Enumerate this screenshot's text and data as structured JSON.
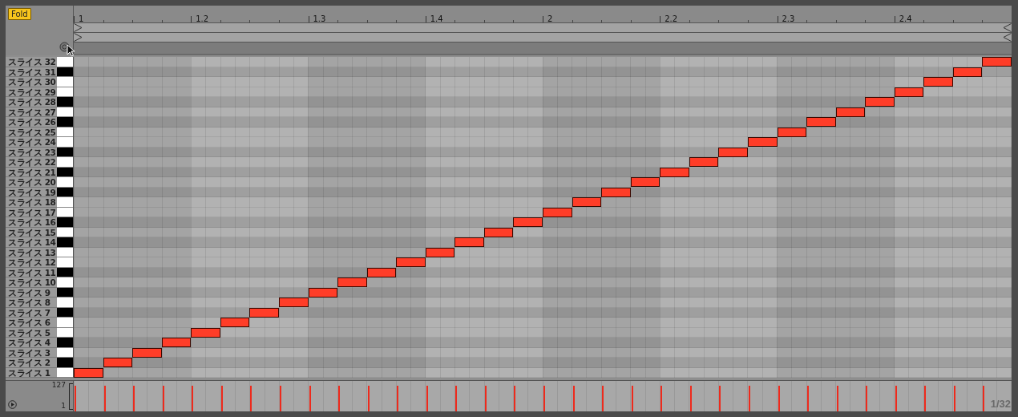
{
  "fold_button": {
    "label": "Fold",
    "on": true
  },
  "ruler": {
    "marks": [
      "1",
      "1.2",
      "1.3",
      "1.4",
      "2",
      "2.2",
      "2.3",
      "2.4"
    ]
  },
  "keys": [
    {
      "label": "スライス 32",
      "kind": "white"
    },
    {
      "label": "スライス 31",
      "kind": "black"
    },
    {
      "label": "スライス 30",
      "kind": "white"
    },
    {
      "label": "スライス 29",
      "kind": "white"
    },
    {
      "label": "スライス 28",
      "kind": "black"
    },
    {
      "label": "スライス 27",
      "kind": "white"
    },
    {
      "label": "スライス 26",
      "kind": "black"
    },
    {
      "label": "スライス 25",
      "kind": "white"
    },
    {
      "label": "スライス 24",
      "kind": "white"
    },
    {
      "label": "スライス 23",
      "kind": "black"
    },
    {
      "label": "スライス 22",
      "kind": "white"
    },
    {
      "label": "スライス 21",
      "kind": "black"
    },
    {
      "label": "スライス 20",
      "kind": "white"
    },
    {
      "label": "スライス 19",
      "kind": "black"
    },
    {
      "label": "スライス 18",
      "kind": "white"
    },
    {
      "label": "スライス 17",
      "kind": "white"
    },
    {
      "label": "スライス 16",
      "kind": "black"
    },
    {
      "label": "スライス 15",
      "kind": "white"
    },
    {
      "label": "スライス 14",
      "kind": "black"
    },
    {
      "label": "スライス 13",
      "kind": "white"
    },
    {
      "label": "スライス 12",
      "kind": "white"
    },
    {
      "label": "スライス 11",
      "kind": "black"
    },
    {
      "label": "スライス 10",
      "kind": "white"
    },
    {
      "label": "スライス 9",
      "kind": "black"
    },
    {
      "label": "スライス 8",
      "kind": "white"
    },
    {
      "label": "スライス 7",
      "kind": "black"
    },
    {
      "label": "スライス 6",
      "kind": "white"
    },
    {
      "label": "スライス 5",
      "kind": "white"
    },
    {
      "label": "スライス 4",
      "kind": "black"
    },
    {
      "label": "スライス 3",
      "kind": "white"
    },
    {
      "label": "スライス 2",
      "kind": "black"
    },
    {
      "label": "スライス 1",
      "kind": "white"
    }
  ],
  "velocity": {
    "max": "127",
    "min": "1"
  },
  "grid_label": "1/32"
}
